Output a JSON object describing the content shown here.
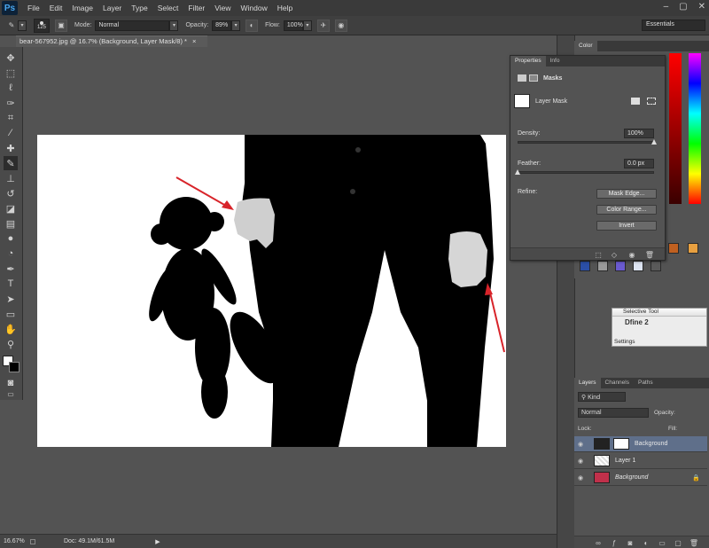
{
  "app": {
    "logo": "Ps",
    "menu": [
      "File",
      "Edit",
      "Image",
      "Layer",
      "Type",
      "Select",
      "Filter",
      "View",
      "Window",
      "Help"
    ],
    "window_controls": [
      "–",
      "▢",
      "✕"
    ]
  },
  "options": {
    "brush_size": "125",
    "mode_label": "Mode:",
    "mode_value": "Normal",
    "opacity_label": "Opacity:",
    "opacity_value": "89%",
    "flow_label": "Flow:",
    "flow_value": "100%",
    "workspace": "Essentials"
  },
  "document": {
    "tab_title": "bear-567952.jpg @ 16.7% (Background, Layer Mask/8) *",
    "close": "×"
  },
  "status": {
    "zoom": "16.67%",
    "doc_size": "Doc: 49.1M/61.5M",
    "arrow": "▶"
  },
  "color_panel": {
    "tab": "Color"
  },
  "properties": {
    "tabs": [
      "Properties",
      "Info"
    ],
    "section": "Masks",
    "mask_name": "Layer Mask",
    "density_label": "Density:",
    "density_value": "100%",
    "density_level": 1.0,
    "feather_label": "Feather:",
    "feather_value": "0.0 px",
    "feather_level": 0.0,
    "refine_label": "Refine:",
    "buttons": [
      "Mask Edge...",
      "Color Range...",
      "Invert"
    ]
  },
  "selective_tool": {
    "title": "Selective Tool",
    "plugin": "Dfine 2",
    "settings": "Settings"
  },
  "layers": {
    "tabs": [
      "Layers",
      "Channels",
      "Paths"
    ],
    "kind": "Kind",
    "blend_mode": "Normal",
    "opacity_label": "Opacity:",
    "lock_label": "Lock:",
    "fill_label": "Fill:",
    "items": [
      {
        "name": "Background",
        "italic": false,
        "selected": true
      },
      {
        "name": "Layer 1",
        "italic": false,
        "selected": false
      },
      {
        "name": "Background",
        "italic": true,
        "selected": false
      }
    ]
  },
  "colors": {
    "menu_bg": "#3a3a3a",
    "panel_bg": "#535353",
    "selected_layer": "#5f6f8a",
    "arrow_red": "#d8242a"
  }
}
